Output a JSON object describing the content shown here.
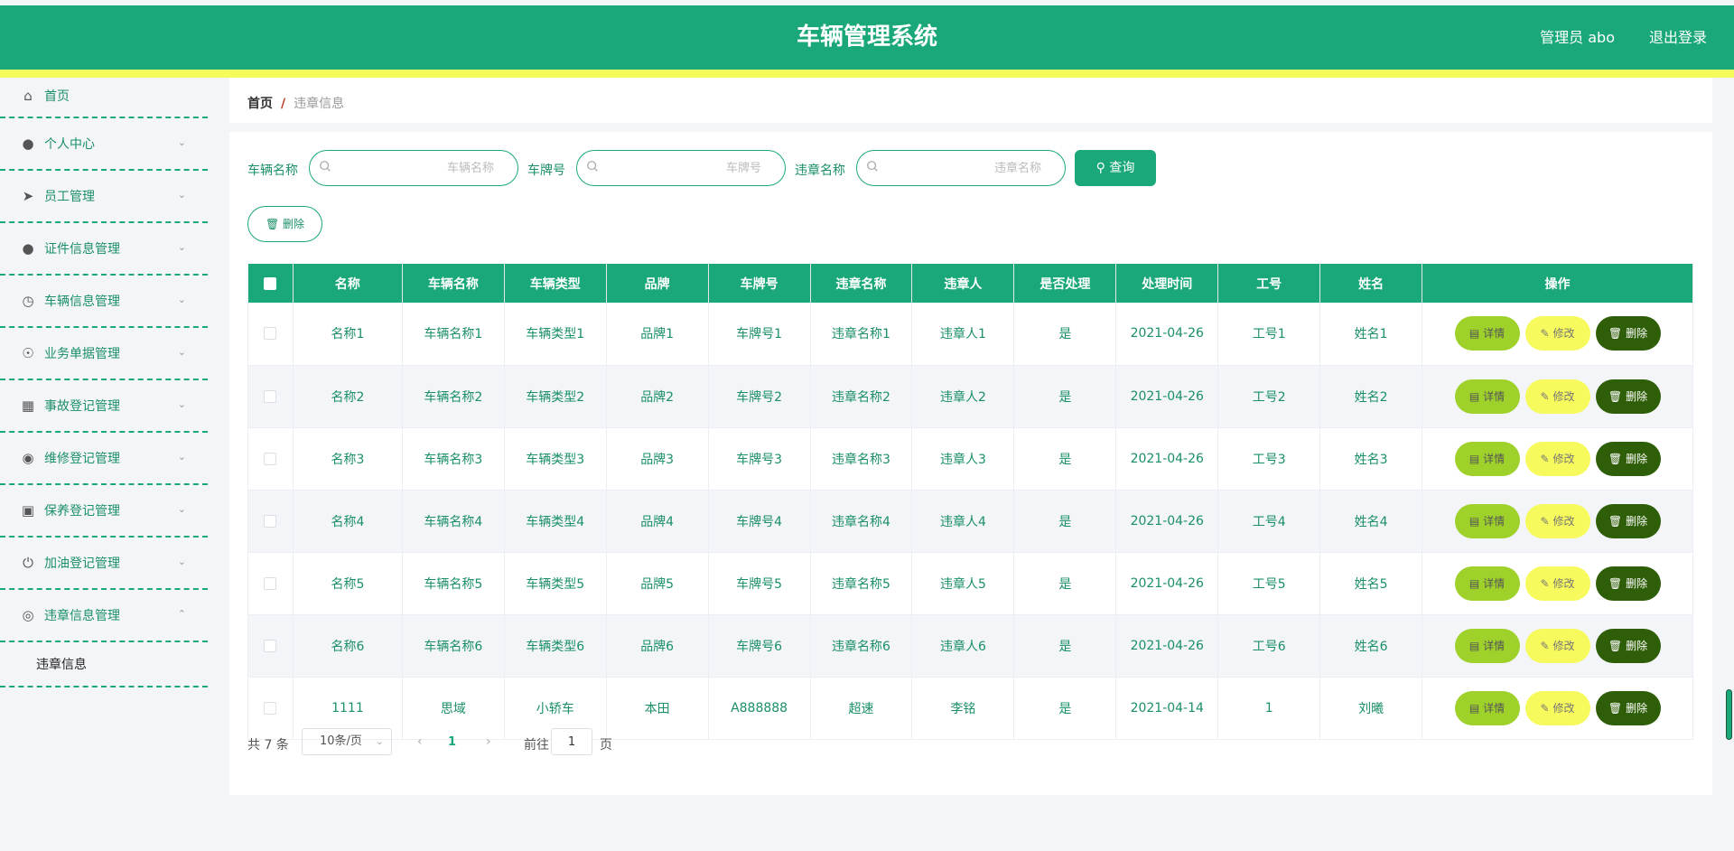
{
  "header": {
    "title": "车辆管理系统",
    "user": "管理员 abo",
    "logout": "退出登录",
    "bg_color": "#1aa87a",
    "accent_color": "#f5fb5a"
  },
  "sidebar": {
    "items": [
      {
        "label": "首页",
        "icon": "home-icon"
      },
      {
        "label": "个人中心",
        "icon": "user-icon"
      },
      {
        "label": "员工管理",
        "icon": "send-icon"
      },
      {
        "label": "证件信息管理",
        "icon": "user-icon"
      },
      {
        "label": "车辆信息管理",
        "icon": "clock-icon"
      },
      {
        "label": "业务单据管理",
        "icon": "compass-icon"
      },
      {
        "label": "事故登记管理",
        "icon": "grid-icon"
      },
      {
        "label": "维修登记管理",
        "icon": "bulb-icon"
      },
      {
        "label": "保养登记管理",
        "icon": "suitcase-icon"
      },
      {
        "label": "加油登记管理",
        "icon": "power-icon"
      },
      {
        "label": "违章信息管理",
        "icon": "target-icon"
      }
    ],
    "submenu": {
      "label": "违章信息"
    }
  },
  "breadcrumb": {
    "home": "首页",
    "separator": "/",
    "current": "违章信息"
  },
  "search": {
    "fields": [
      {
        "label": "车辆名称",
        "placeholder": "车辆名称"
      },
      {
        "label": "车牌号",
        "placeholder": "车牌号"
      },
      {
        "label": "违章名称",
        "placeholder": "违章名称"
      }
    ],
    "query_label": "查询",
    "delete_label": "删除"
  },
  "table": {
    "headers": [
      "名称",
      "车辆名称",
      "车辆类型",
      "品牌",
      "车牌号",
      "违章名称",
      "违章人",
      "是否处理",
      "处理时间",
      "工号",
      "姓名",
      "操作"
    ],
    "rows": [
      [
        "名称1",
        "车辆名称1",
        "车辆类型1",
        "品牌1",
        "车牌号1",
        "违章名称1",
        "违章人1",
        "是",
        "2021-04-26",
        "工号1",
        "姓名1"
      ],
      [
        "名称2",
        "车辆名称2",
        "车辆类型2",
        "品牌2",
        "车牌号2",
        "违章名称2",
        "违章人2",
        "是",
        "2021-04-26",
        "工号2",
        "姓名2"
      ],
      [
        "名称3",
        "车辆名称3",
        "车辆类型3",
        "品牌3",
        "车牌号3",
        "违章名称3",
        "违章人3",
        "是",
        "2021-04-26",
        "工号3",
        "姓名3"
      ],
      [
        "名称4",
        "车辆名称4",
        "车辆类型4",
        "品牌4",
        "车牌号4",
        "违章名称4",
        "违章人4",
        "是",
        "2021-04-26",
        "工号4",
        "姓名4"
      ],
      [
        "名称5",
        "车辆名称5",
        "车辆类型5",
        "品牌5",
        "车牌号5",
        "违章名称5",
        "违章人5",
        "是",
        "2021-04-26",
        "工号5",
        "姓名5"
      ],
      [
        "名称6",
        "车辆名称6",
        "车辆类型6",
        "品牌6",
        "车牌号6",
        "违章名称6",
        "违章人6",
        "是",
        "2021-04-26",
        "工号6",
        "姓名6"
      ],
      [
        "1111",
        "思域",
        "小轿车",
        "本田",
        "A888888",
        "超速",
        "李铭",
        "是",
        "2021-04-14",
        "1",
        "刘曦"
      ]
    ],
    "actions": {
      "detail": "详情",
      "edit": "修改",
      "delete": "删除"
    }
  },
  "pagination": {
    "total": "共 7 条",
    "page_size": "10条/页",
    "current_page": "1",
    "goto_prefix": "前往",
    "goto_value": "1",
    "goto_suffix": "页"
  }
}
